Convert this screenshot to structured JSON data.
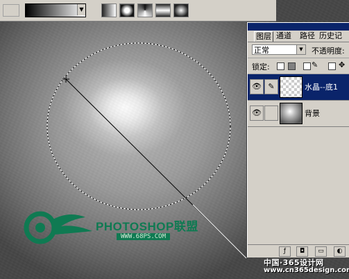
{
  "panel": {
    "tabs": [
      "图层",
      "通道",
      "路径",
      "历史记"
    ],
    "blend_mode": "正常",
    "opacity_label": "不透明度:",
    "lock_label": "锁定:",
    "layers": [
      {
        "name": "水晶--底1",
        "selected": true,
        "thumb": "transparent"
      },
      {
        "name": "背景",
        "selected": false,
        "thumb": "background"
      }
    ]
  },
  "watermark": {
    "brand": "PHOTOSHOP联盟",
    "url": "WWW.68PS.COM"
  },
  "footer": {
    "line1": "中国·365设计网",
    "line2": "www.cn365design.com"
  },
  "colors": {
    "selection": "#0a246a",
    "watermark_green": "#0f7a52"
  }
}
